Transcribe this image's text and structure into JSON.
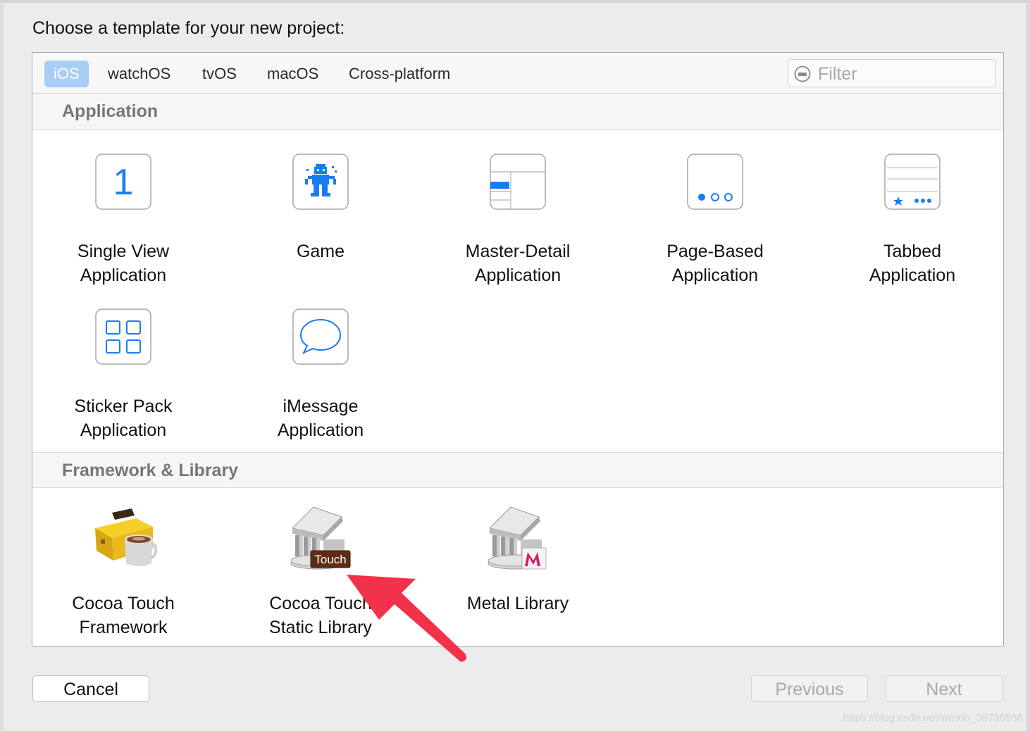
{
  "dialog": {
    "heading": "Choose a template for your new project:"
  },
  "tabs": [
    {
      "label": "iOS",
      "selected": true
    },
    {
      "label": "watchOS",
      "selected": false
    },
    {
      "label": "tvOS",
      "selected": false
    },
    {
      "label": "macOS",
      "selected": false
    },
    {
      "label": "Cross-platform",
      "selected": false
    }
  ],
  "filter": {
    "placeholder": "Filter",
    "value": "",
    "icon": "filter-icon"
  },
  "sections": [
    {
      "title": "Application",
      "templates": [
        {
          "label": "Single View\nApplication",
          "icon": "single-view-icon"
        },
        {
          "label": "Game",
          "icon": "game-icon"
        },
        {
          "label": "Master-Detail\nApplication",
          "icon": "master-detail-icon"
        },
        {
          "label": "Page-Based\nApplication",
          "icon": "page-based-icon"
        },
        {
          "label": "Tabbed\nApplication",
          "icon": "tabbed-icon"
        },
        {
          "label": "Sticker Pack\nApplication",
          "icon": "sticker-pack-icon"
        },
        {
          "label": "iMessage\nApplication",
          "icon": "imessage-icon"
        }
      ]
    },
    {
      "title": "Framework & Library",
      "templates": [
        {
          "label": "Cocoa Touch\nFramework",
          "icon": "toolbox-icon"
        },
        {
          "label": "Cocoa Touch\nStatic Library",
          "icon": "library-touch-icon",
          "badge": "Touch"
        },
        {
          "label": "Metal Library",
          "icon": "metal-library-icon"
        }
      ]
    }
  ],
  "icon_text": {
    "single_view_number": "1"
  },
  "buttons": {
    "cancel": "Cancel",
    "previous": "Previous",
    "next": "Next"
  },
  "annotation": {
    "arrow_color": "#f2324a"
  },
  "watermark": "https://blog.csdn.net/weixin_38735568",
  "colors": {
    "accent": "#1a7cf5",
    "tab_selected_bg": "#a8cdf7",
    "disabled_text": "#aaaaaa"
  }
}
